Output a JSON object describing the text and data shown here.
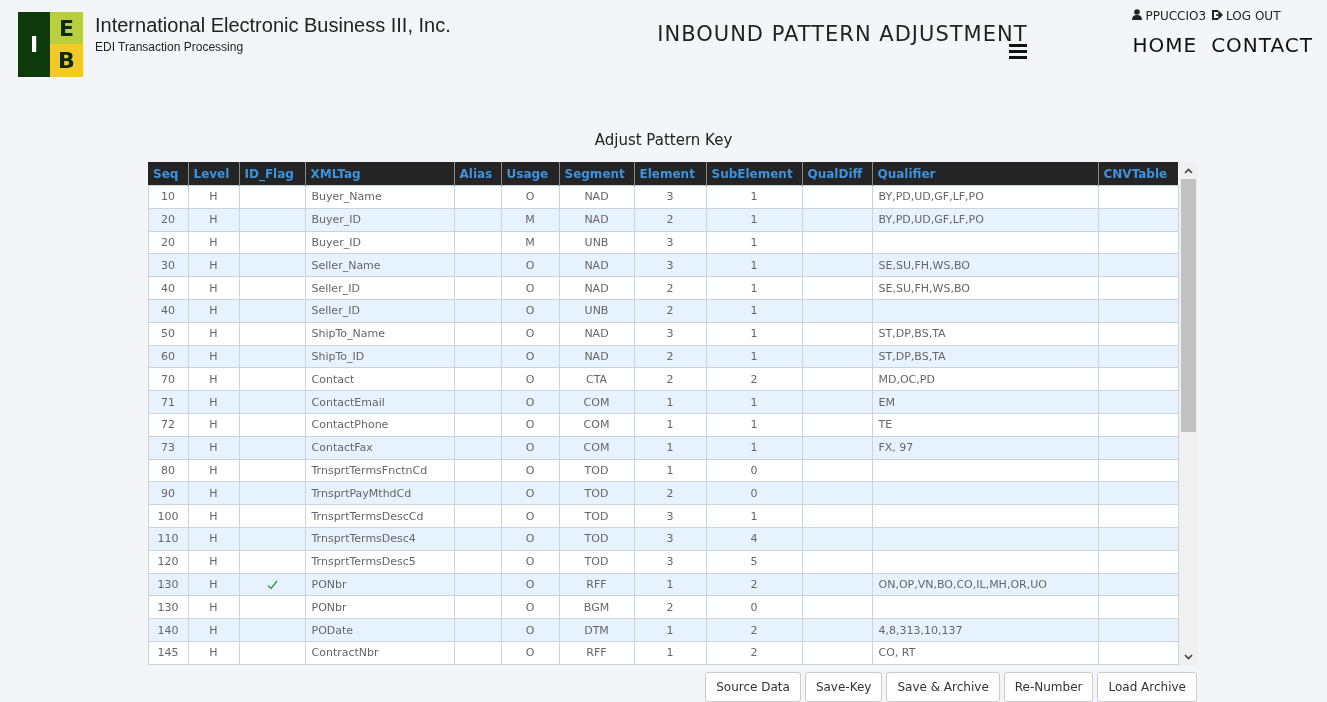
{
  "header": {
    "logo_letters": [
      "I",
      "E",
      "B"
    ],
    "company": "International Electronic Business III, Inc.",
    "tagline": "EDI Transaction Processing",
    "page_title": "INBOUND PATTERN ADJUSTMENT",
    "user": "PPUCCIO3",
    "logout": "LOG OUT",
    "nav": [
      "HOME",
      "CONTACT"
    ]
  },
  "section_title": "Adjust Pattern Key",
  "table": {
    "columns": [
      "Seq",
      "Level",
      "ID_Flag",
      "XMLTag",
      "Alias",
      "Usage",
      "Segment",
      "Element",
      "SubElement",
      "QualDiff",
      "Qualifier",
      "CNVTable"
    ],
    "rows": [
      {
        "seq": "10",
        "level": "H",
        "id_flag": false,
        "xmltag": "Buyer_Name",
        "usage": "O",
        "segment": "NAD",
        "element": "3",
        "subelement": "1",
        "qualifier": "BY,PD,UD,GF,LF,PO"
      },
      {
        "seq": "20",
        "level": "H",
        "id_flag": false,
        "xmltag": "Buyer_ID",
        "usage": "M",
        "segment": "NAD",
        "element": "2",
        "subelement": "1",
        "qualifier": "BY,PD,UD,GF,LF,PO"
      },
      {
        "seq": "20",
        "level": "H",
        "id_flag": false,
        "xmltag": "Buyer_ID",
        "usage": "M",
        "segment": "UNB",
        "element": "3",
        "subelement": "1"
      },
      {
        "seq": "30",
        "level": "H",
        "id_flag": false,
        "xmltag": "Seller_Name",
        "usage": "O",
        "segment": "NAD",
        "element": "3",
        "subelement": "1",
        "qualifier": "SE,SU,FH,WS,BO"
      },
      {
        "seq": "40",
        "level": "H",
        "id_flag": false,
        "xmltag": "Seller_ID",
        "usage": "O",
        "segment": "NAD",
        "element": "2",
        "subelement": "1",
        "qualifier": "SE,SU,FH,WS,BO"
      },
      {
        "seq": "40",
        "level": "H",
        "id_flag": false,
        "xmltag": "Seller_ID",
        "usage": "O",
        "segment": "UNB",
        "element": "2",
        "subelement": "1"
      },
      {
        "seq": "50",
        "level": "H",
        "id_flag": false,
        "xmltag": "ShipTo_Name",
        "usage": "O",
        "segment": "NAD",
        "element": "3",
        "subelement": "1",
        "qualifier": "ST,DP,BS,TA"
      },
      {
        "seq": "60",
        "level": "H",
        "id_flag": false,
        "xmltag": "ShipTo_ID",
        "usage": "O",
        "segment": "NAD",
        "element": "2",
        "subelement": "1",
        "qualifier": "ST,DP,BS,TA"
      },
      {
        "seq": "70",
        "level": "H",
        "id_flag": false,
        "xmltag": "Contact",
        "usage": "O",
        "segment": "CTA",
        "element": "2",
        "subelement": "2",
        "qualifier": "MD,OC,PD"
      },
      {
        "seq": "71",
        "level": "H",
        "id_flag": false,
        "xmltag": "ContactEmail",
        "usage": "O",
        "segment": "COM",
        "element": "1",
        "subelement": "1",
        "qualifier": "EM"
      },
      {
        "seq": "72",
        "level": "H",
        "id_flag": false,
        "xmltag": "ContactPhone",
        "usage": "O",
        "segment": "COM",
        "element": "1",
        "subelement": "1",
        "qualifier": "TE"
      },
      {
        "seq": "73",
        "level": "H",
        "id_flag": false,
        "xmltag": "ContactFax",
        "usage": "O",
        "segment": "COM",
        "element": "1",
        "subelement": "1",
        "qualifier": "FX, 97"
      },
      {
        "seq": "80",
        "level": "H",
        "id_flag": false,
        "xmltag": "TrnsprtTermsFnctnCd",
        "usage": "O",
        "segment": "TOD",
        "element": "1",
        "subelement": "0"
      },
      {
        "seq": "90",
        "level": "H",
        "id_flag": false,
        "xmltag": "TrnsprtPayMthdCd",
        "usage": "O",
        "segment": "TOD",
        "element": "2",
        "subelement": "0"
      },
      {
        "seq": "100",
        "level": "H",
        "id_flag": false,
        "xmltag": "TrnsprtTermsDescCd",
        "usage": "O",
        "segment": "TOD",
        "element": "3",
        "subelement": "1"
      },
      {
        "seq": "110",
        "level": "H",
        "id_flag": false,
        "xmltag": "TrnsprtTermsDesc4",
        "usage": "O",
        "segment": "TOD",
        "element": "3",
        "subelement": "4"
      },
      {
        "seq": "120",
        "level": "H",
        "id_flag": false,
        "xmltag": "TrnsprtTermsDesc5",
        "usage": "O",
        "segment": "TOD",
        "element": "3",
        "subelement": "5"
      },
      {
        "seq": "130",
        "level": "H",
        "id_flag": true,
        "xmltag": "PONbr",
        "usage": "O",
        "segment": "RFF",
        "element": "1",
        "subelement": "2",
        "qualifier": "ON,OP,VN,BO,CO,IL,MH,OR,UO"
      },
      {
        "seq": "130",
        "level": "H",
        "id_flag": false,
        "xmltag": "PONbr",
        "usage": "O",
        "segment": "BGM",
        "element": "2",
        "subelement": "0"
      },
      {
        "seq": "140",
        "level": "H",
        "id_flag": false,
        "xmltag": "PODate",
        "usage": "O",
        "segment": "DTM",
        "element": "1",
        "subelement": "2",
        "qualifier": "4,8,313,10,137"
      },
      {
        "seq": "145",
        "level": "H",
        "id_flag": false,
        "xmltag": "ContractNbr",
        "usage": "O",
        "segment": "RFF",
        "element": "1",
        "subelement": "2",
        "qualifier": "CO, RT"
      }
    ]
  },
  "buttons": [
    "Source Data",
    "Save-Key",
    "Save & Archive",
    "Re-Number",
    "Load Archive"
  ]
}
